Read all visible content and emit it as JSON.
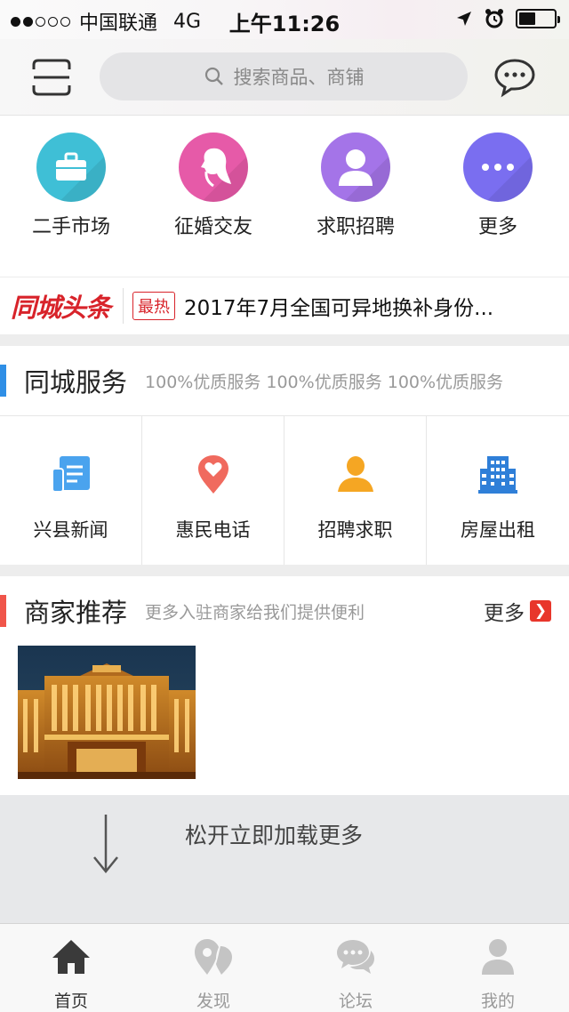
{
  "status_bar": {
    "carrier": "中国联通",
    "network": "4G",
    "time": "上午11:26",
    "signal_bars": 2
  },
  "header": {
    "search_placeholder": "搜索商品、商铺",
    "scan_icon": "scan-icon",
    "message_icon": "chat-bubble-icon"
  },
  "categories": [
    {
      "label": "二手市场",
      "icon": "briefcase-icon",
      "color": "#3fbfd6"
    },
    {
      "label": "征婚交友",
      "icon": "woman-profile-icon",
      "color": "#e65aa8"
    },
    {
      "label": "求职招聘",
      "icon": "person-icon",
      "color": "#a474e8"
    },
    {
      "label": "更多",
      "icon": "more-dots-icon",
      "color": "#7a6ef0"
    }
  ],
  "headline": {
    "logo": "同城头条",
    "badge": "最热",
    "text": "2017年7月全国可异地换补身份..."
  },
  "services": {
    "title": "同城服务",
    "subtitle": "100%优质服务 100%优质服务 100%优质服务",
    "accent": "#2f8fe6",
    "items": [
      {
        "label": "兴县新闻",
        "icon": "newspaper-icon",
        "color": "#4aa3ee"
      },
      {
        "label": "惠民电话",
        "icon": "heart-pin-icon",
        "color": "#f06a5e"
      },
      {
        "label": "招聘求职",
        "icon": "user-icon",
        "color": "#f5a623"
      },
      {
        "label": "房屋出租",
        "icon": "building-icon",
        "color": "#2f7fd8"
      }
    ]
  },
  "merchants": {
    "title": "商家推荐",
    "subtitle": "更多入驻商家给我们提供便利",
    "more_label": "更多",
    "accent": "#f0554a"
  },
  "load_more": {
    "text": "松开立即加载更多"
  },
  "tabs": [
    {
      "label": "首页",
      "icon": "home-icon",
      "active": true
    },
    {
      "label": "发现",
      "icon": "discover-pin-icon",
      "active": false
    },
    {
      "label": "论坛",
      "icon": "forum-chat-icon",
      "active": false
    },
    {
      "label": "我的",
      "icon": "profile-icon",
      "active": false
    }
  ]
}
